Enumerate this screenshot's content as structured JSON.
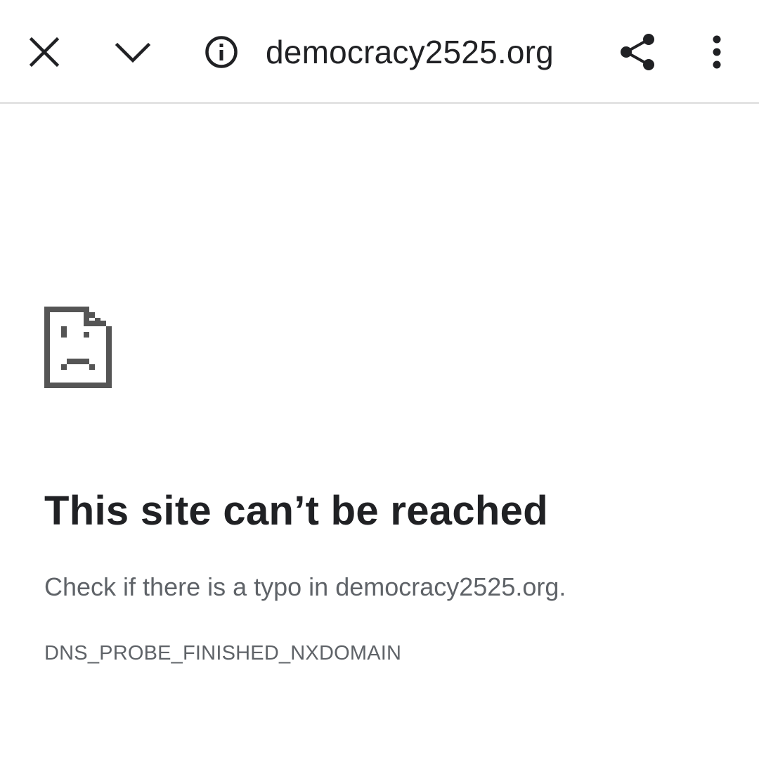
{
  "toolbar": {
    "url": "democracy2525.org",
    "icons": {
      "close": "close-icon",
      "minimize": "chevron-down-icon",
      "info": "info-icon",
      "share": "share-icon",
      "menu": "more-vert-icon"
    }
  },
  "error_page": {
    "icon": "sad-page-icon",
    "headline": "This site can’t be reached",
    "suggestion": "Check if there is a typo in democracy2525.org.",
    "error_code": "DNS_PROBE_FINISHED_NXDOMAIN"
  },
  "colors": {
    "text_primary": "#202124",
    "text_secondary": "#5f6368",
    "icon": "#555555",
    "divider": "#e3e3e3"
  }
}
